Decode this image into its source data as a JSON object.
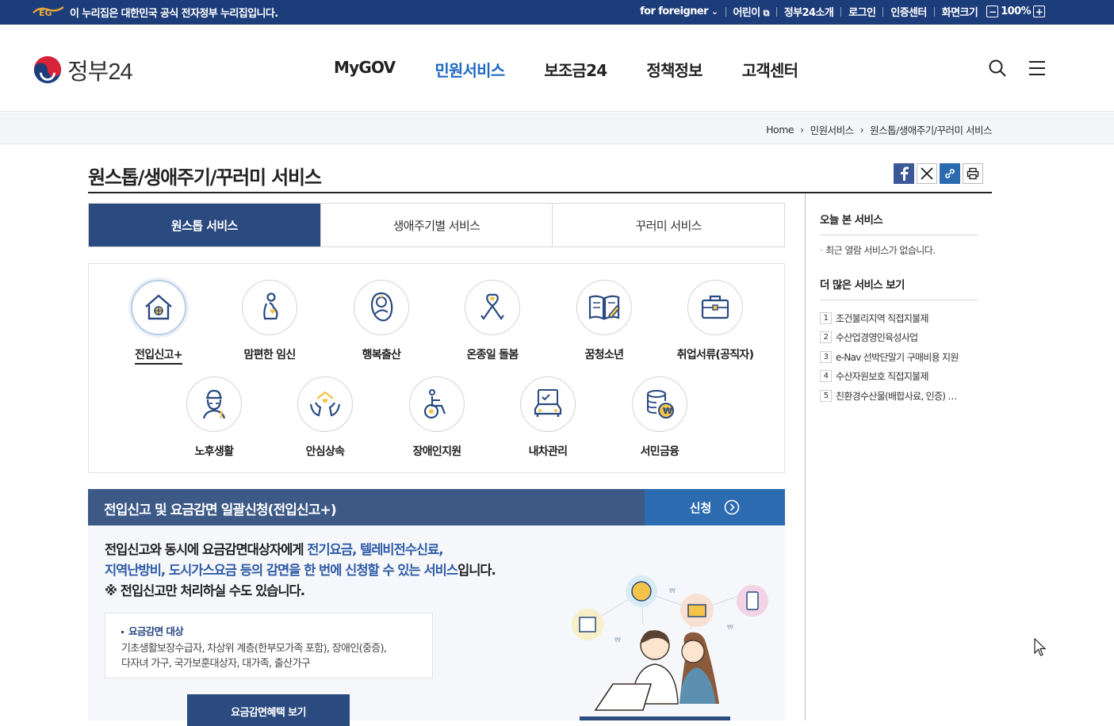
{
  "topbar": {
    "notice": "이 누리집은 대한민국 공식 전자정부 누리집입니다.",
    "links": [
      "for foreigner",
      "어린이",
      "정부24소개",
      "로그인",
      "인증센터",
      "화면크기"
    ],
    "zoom_minus": "−",
    "zoom_value": "100%",
    "zoom_plus": "+"
  },
  "header": {
    "logo_text": "정부24",
    "nav": [
      "MyGOV",
      "민원서비스",
      "보조금24",
      "정책정보",
      "고객센터"
    ],
    "active_nav": "민원서비스",
    "icons": [
      "search-icon",
      "menu-icon"
    ]
  },
  "breadcrumb": [
    "Home",
    "민원서비스",
    "원스톱/생애주기/꾸러미 서비스"
  ],
  "page": {
    "title": "원스톱/생애주기/꾸러미 서비스",
    "share_icons": [
      "facebook-icon",
      "x-icon",
      "link-icon",
      "print-icon"
    ]
  },
  "tabs": [
    "원스톱 서비스",
    "생애주기별 서비스",
    "꾸러미 서비스"
  ],
  "active_tab": "원스톱 서비스",
  "services": [
    {
      "label": "전입신고+",
      "icon": "house-icon"
    },
    {
      "label": "맘편한 임신",
      "icon": "pregnant-icon"
    },
    {
      "label": "행복출산",
      "icon": "baby-icon"
    },
    {
      "label": "온종일 돌봄",
      "icon": "ribbon-icon"
    },
    {
      "label": "꿈청소년",
      "icon": "book-icon"
    },
    {
      "label": "취업서류(공직자)",
      "icon": "briefcase-icon"
    },
    {
      "label": "노후생활",
      "icon": "elder-icon"
    },
    {
      "label": "안심상속",
      "icon": "hands-house-icon"
    },
    {
      "label": "장애인지원",
      "icon": "wheelchair-icon"
    },
    {
      "label": "내차관리",
      "icon": "car-icon"
    },
    {
      "label": "서민금융",
      "icon": "coins-icon"
    }
  ],
  "detail": {
    "title": "전입신고 및 요금감면 일괄신청(전입신고+)",
    "apply_label": "신청",
    "desc_1a": "전입신고와 동시에 요금감면대상자에게 ",
    "desc_1b": "전기요금, 텔레비전수신료,",
    "desc_2a": "지역난방비, 도시가스요금 등의 감면을 한 번에 신청할 수 있는 서비스",
    "desc_2b": "입니다.",
    "desc_3": "※ 전입신고만 처리하실 수도 있습니다.",
    "target_title": "요금감면 대상",
    "target_line1": "기초생활보장수급자, 차상위 계층(한부모가족 포함), 장애인(중증),",
    "target_line2": "다자녀 가구, 국가보훈대상자, 대가족, 출산가구",
    "benefit_button": "요금감면혜택 보기"
  },
  "side": {
    "recent_title": "오늘 본 서비스",
    "recent_empty": "최근 열람 서비스가 없습니다.",
    "more_title": "더 많은 서비스 보기",
    "more_items": [
      {
        "n": "1",
        "label": "조건불리지역 직접지불제"
      },
      {
        "n": "2",
        "label": "수산업경영인육성사업"
      },
      {
        "n": "3",
        "label": "e-Nav 선박단말기 구매비용 지원"
      },
      {
        "n": "4",
        "label": "수산자원보호 직접지불제"
      },
      {
        "n": "5",
        "label": "친환경수산물(배합사료, 인증) …"
      }
    ]
  },
  "colors": {
    "topbar": "#1d3d7a",
    "accent": "#1f6ac0",
    "tab_active": "#2a4a80",
    "panel_head": "#3d5a87",
    "apply": "#2d6bb0"
  }
}
